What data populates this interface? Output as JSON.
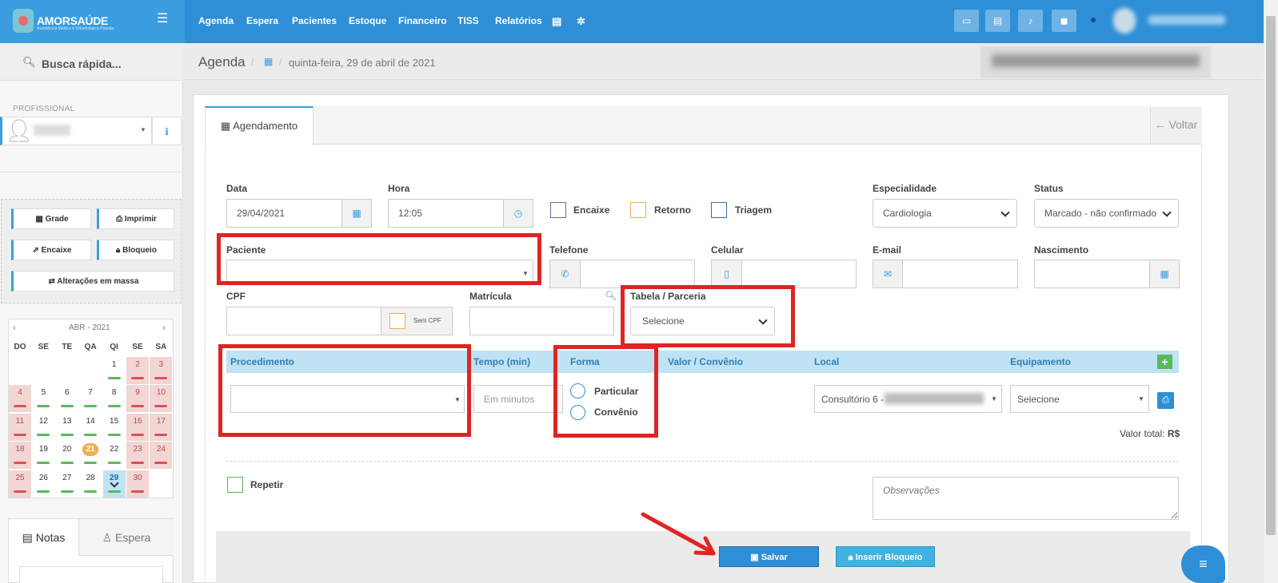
{
  "brand": {
    "name": "AMORSAÚDE",
    "subtitle": "Assistência Médica e Odontológica Popular"
  },
  "nav": [
    "Agenda",
    "Espera",
    "Pacientes",
    "Estoque",
    "Financeiro",
    "TISS",
    "Relatórios"
  ],
  "sidebar": {
    "search_label": "Busca rápida...",
    "profissional_label": "PROFISSIONAL",
    "buttons": {
      "grade": "Grade",
      "imprimir": "Imprimir",
      "encaixe": "Encaixe",
      "bloqueio": "Bloqueio",
      "alteracoes": "Alterações em massa"
    },
    "calendar": {
      "title": "ABR - 2021",
      "weekdays": [
        "DO",
        "SE",
        "TE",
        "QA",
        "QI",
        "SE",
        "SA"
      ],
      "rows": [
        [
          "",
          "",
          "",
          "",
          "1",
          "2",
          "3"
        ],
        [
          "4",
          "5",
          "6",
          "7",
          "8",
          "9",
          "10"
        ],
        [
          "11",
          "12",
          "13",
          "14",
          "15",
          "16",
          "17"
        ],
        [
          "18",
          "19",
          "20",
          "21",
          "22",
          "23",
          "24"
        ],
        [
          "25",
          "26",
          "27",
          "28",
          "29",
          "30",
          ""
        ]
      ],
      "today": "21",
      "selected": "29"
    },
    "tabs": {
      "notas": "Notas",
      "espera": "Espera"
    }
  },
  "header": {
    "title": "Agenda",
    "date": "quinta-feira, 29 de abril de 2021"
  },
  "form": {
    "tab": "Agendamento",
    "back": "Voltar",
    "data": {
      "label": "Data",
      "value": "29/04/2021"
    },
    "hora": {
      "label": "Hora",
      "value": "12:05"
    },
    "encaixe": "Encaixe",
    "retorno": "Retorno",
    "triagem": "Triagem",
    "especialidade": {
      "label": "Especialidade",
      "value": "Cardiologia"
    },
    "status": {
      "label": "Status",
      "value": "Marcado - não confirmado"
    },
    "paciente": {
      "label": "Paciente",
      "value": ""
    },
    "telefone": {
      "label": "Telefone",
      "value": ""
    },
    "celular": {
      "label": "Celular",
      "value": ""
    },
    "email": {
      "label": "E-mail",
      "value": ""
    },
    "nascimento": {
      "label": "Nascimento",
      "value": ""
    },
    "cpf": {
      "label": "CPF",
      "value": ""
    },
    "sem_cpf": "Sem CPF",
    "matricula": {
      "label": "Matrícula",
      "value": ""
    },
    "tabela": {
      "label": "Tabela / Parceria",
      "value": "Selecione"
    },
    "table_headers": {
      "procedimento": "Procedimento",
      "tempo": "Tempo (min)",
      "forma": "Forma",
      "valor": "Valor / Convênio",
      "local": "Local",
      "equipamento": "Equipamento"
    },
    "tempo_placeholder": "Em minutos",
    "forma_options": [
      "Particular",
      "Convênio"
    ],
    "local_value": "Consultório 6 -",
    "equipamento_value": "Selecione",
    "valor_total_label": "Valor total:",
    "valor_total_currency": "R$",
    "repetir": "Repetir",
    "observacoes_placeholder": "Observações",
    "salvar": "Salvar",
    "inserir_bloqueio": "Inserir Bloqueio"
  },
  "colors": {
    "topbar": "#2e8fd6",
    "accent": "#3a9de0",
    "highlight": "#e02424",
    "success": "#5cb85c",
    "today": "#f0ad4e"
  }
}
